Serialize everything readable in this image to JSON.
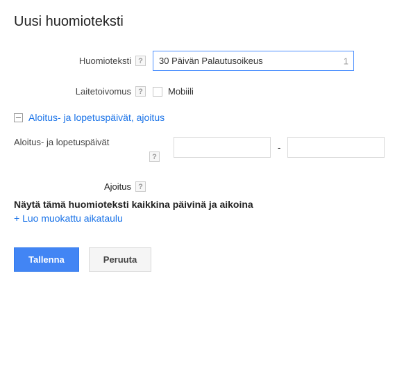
{
  "title": "Uusi huomioteksti",
  "fields": {
    "huomioteksti": {
      "label": "Huomioteksti",
      "value": "30 Päivän Palautusoikeus",
      "counter": "1"
    },
    "laitetoivomus": {
      "label": "Laitetoivomus",
      "checkbox_label": "Mobiili"
    }
  },
  "section": {
    "header": "Aloitus- ja lopetuspäivät, ajoitus",
    "date_label": "Aloitus- ja lopetuspäivät",
    "date_sep": "-",
    "ajoitus_label": "Ajoitus",
    "schedule_text": "Näytä tämä huomioteksti kaikkina päivinä ja aikoina",
    "create_schedule": "+ Luo muokattu aikataulu"
  },
  "buttons": {
    "save": "Tallenna",
    "cancel": "Peruuta"
  },
  "help_symbol": "?"
}
